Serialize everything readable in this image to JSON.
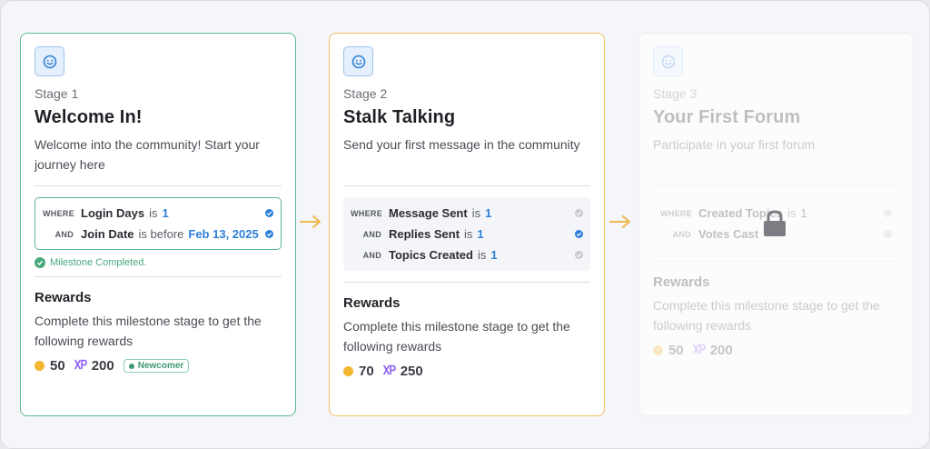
{
  "stages": [
    {
      "stage_label": "Stage 1",
      "title": "Welcome In!",
      "description": "Welcome into the community! Start your journey here",
      "conditions": [
        {
          "keyword": "WHERE",
          "field": "Login Days",
          "operator": "is",
          "value": "1",
          "checked": true
        },
        {
          "keyword": "AND",
          "field": "Join Date",
          "operator": "is before",
          "value": "Feb 13, 2025",
          "checked": true
        }
      ],
      "milestone_text": "Milestone Completed.",
      "rewards_title": "Rewards",
      "rewards_description": "Complete this milestone stage to get the following rewards",
      "coins": "50",
      "xp": "200",
      "tag": "Newcomer"
    },
    {
      "stage_label": "Stage 2",
      "title": "Stalk Talking",
      "description": "Send your first message in the community",
      "conditions": [
        {
          "keyword": "WHERE",
          "field": "Message Sent",
          "operator": "is",
          "value": "1",
          "checked": false
        },
        {
          "keyword": "AND",
          "field": "Replies Sent",
          "operator": "is",
          "value": "1",
          "checked": true
        },
        {
          "keyword": "AND",
          "field": "Topics Created",
          "operator": "is",
          "value": "1",
          "checked": false
        }
      ],
      "rewards_title": "Rewards",
      "rewards_description": "Complete this milestone stage to get the following rewards",
      "coins": "70",
      "xp": "250"
    },
    {
      "stage_label": "Stage 3",
      "title": "Your First Forum",
      "description": "Participate in your first forum",
      "conditions": [
        {
          "keyword": "WHERE",
          "field": "Created Topics",
          "operator": "is",
          "value": "1",
          "checked": false
        },
        {
          "keyword": "AND",
          "field": "Votes Cast",
          "operator": "",
          "value": "",
          "checked": false
        }
      ],
      "rewards_title": "Rewards",
      "rewards_description": "Complete this milestone stage to get the following rewards",
      "coins": "50",
      "xp": "200",
      "locked": true
    }
  ],
  "icons": {
    "stage_badge": "smiley-icon",
    "arrow": "arrow-right-icon",
    "lock": "lock-icon",
    "check": "check-icon",
    "coin": "coin-icon",
    "xp": "xp-icon"
  },
  "colors": {
    "completed": "#5cb892",
    "active": "#f0c064",
    "accent_blue": "#2e7fd8",
    "coin": "#f2b631",
    "xp": "#8b5cf6"
  }
}
